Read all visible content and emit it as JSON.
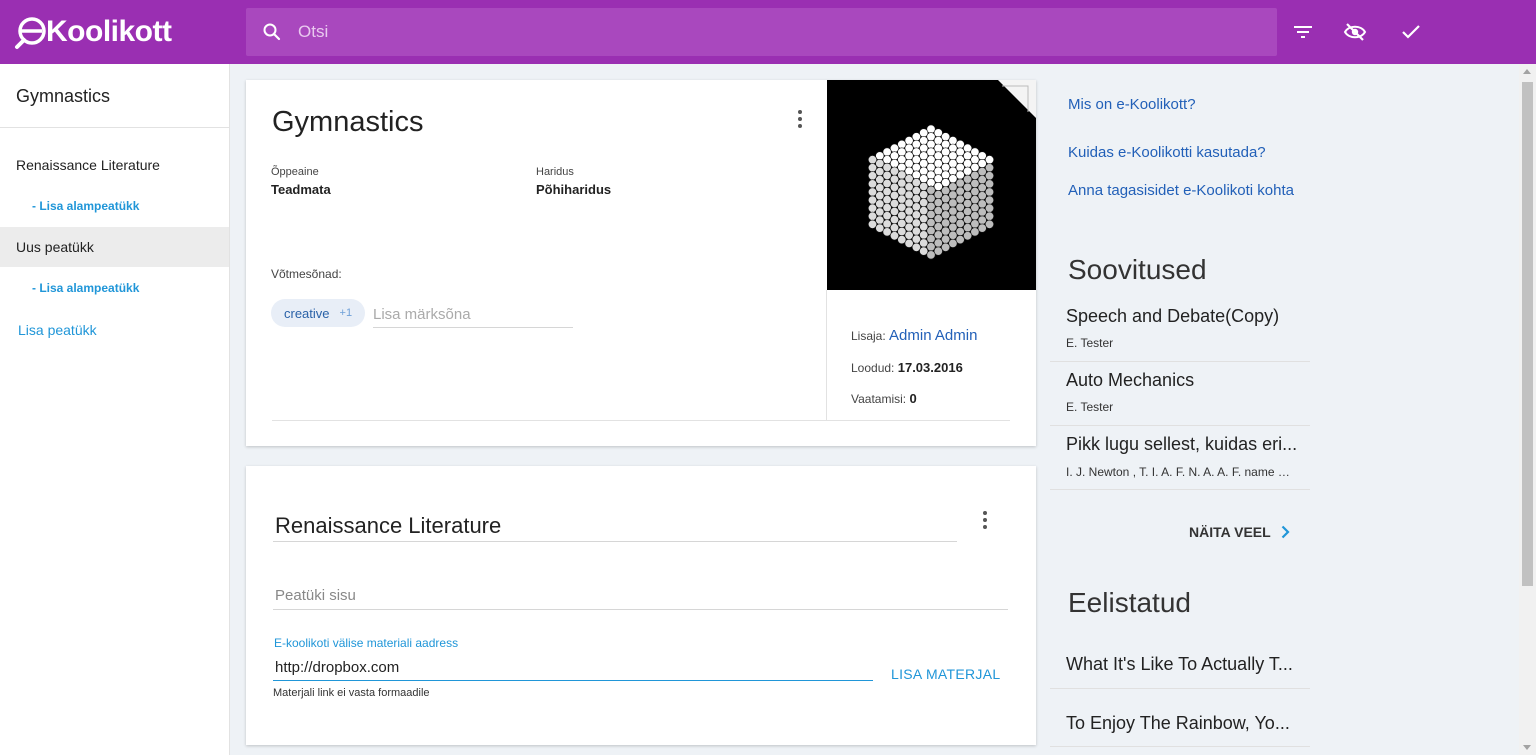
{
  "brand": {
    "name": "Koolikott",
    "accent": "#9a2fb2"
  },
  "search": {
    "placeholder": "Otsi"
  },
  "toolbar": {
    "icons": [
      "filter-icon",
      "visibility-off-icon",
      "check-icon"
    ]
  },
  "sidebar": {
    "title": "Gymnastics",
    "items": [
      {
        "label": "Renaissance Literature",
        "sub": "- Lisa alampeatükk"
      },
      {
        "label": "Uus peatükk",
        "sub": "- Lisa alampeatükk"
      }
    ],
    "add_chapter": "Lisa peatükk"
  },
  "material": {
    "title": "Gymnastics",
    "subject_label": "Õppeaine",
    "subject_value": "Teadmata",
    "education_label": "Haridus",
    "education_value": "Põhiharidus",
    "keywords_label": "Võtmesõnad:",
    "keyword_chip": "creative",
    "keyword_more": "+1",
    "keyword_placeholder": "Lisa märksõna",
    "added_by_label": "Lisaja:",
    "added_by_value": "Admin Admin",
    "created_label": "Loodud:",
    "created_value": "17.03.2016",
    "views_label": "Vaatamisi:",
    "views_value": "0"
  },
  "chapter": {
    "title": "Renaissance Literature",
    "content_placeholder": "Peatüki sisu",
    "url_label": "E-koolikoti välise materiali aadress",
    "url_value": "http://dropbox.com",
    "url_hint": "Materjali link ei vasta formaadile",
    "add_button": "LISA MATERJAL"
  },
  "right": {
    "links": [
      "Mis on e-Koolikott?",
      "Kuidas e-Koolikotti kasutada?",
      "Anna tagasisidet e-Koolikoti kohta"
    ],
    "recommendations_title": "Soovitused",
    "recommendations": [
      {
        "title": "Speech and Debate(Copy)",
        "author": "E. Tester"
      },
      {
        "title": "Auto Mechanics",
        "author": "E. Tester"
      },
      {
        "title": "Pikk lugu sellest, kuidas eri...",
        "author": "I. J. Newton , T. I. A. F. N. A. A. F. name , ..."
      }
    ],
    "show_more": "NÄITA VEEL",
    "featured_title": "Eelistatud",
    "featured": [
      {
        "title": "What It's Like To Actually T..."
      },
      {
        "title": "To Enjoy The Rainbow, Yo..."
      }
    ]
  }
}
